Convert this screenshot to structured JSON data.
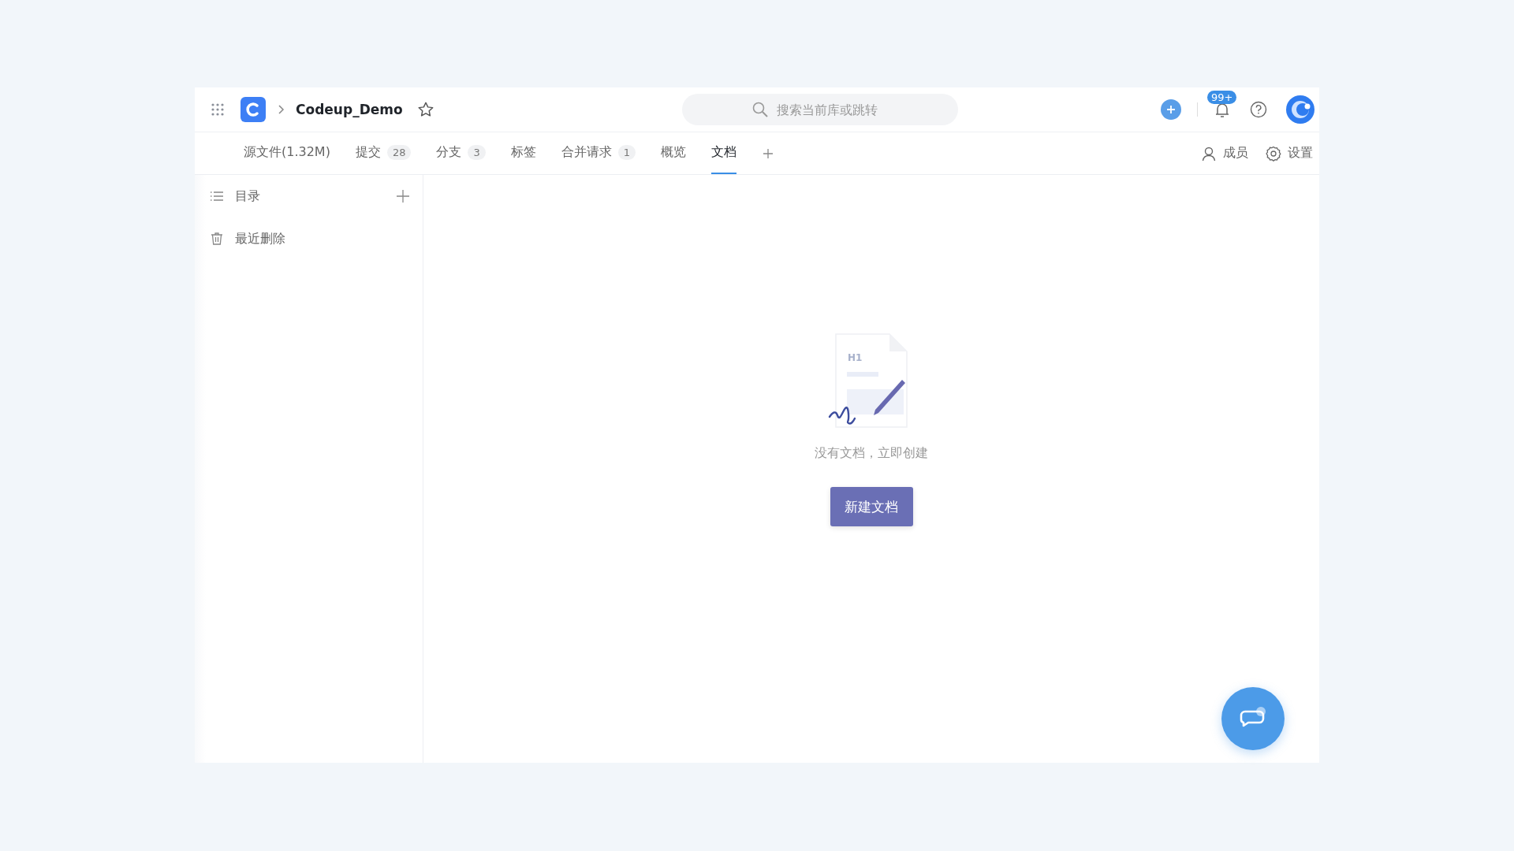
{
  "header": {
    "repo_name": "Codeup_Demo",
    "starred": false,
    "search": {
      "placeholder": "搜索当前库或跳转"
    },
    "notification_badge": "99+"
  },
  "tabs": [
    {
      "label": "源文件(1.32M)",
      "selected": false
    },
    {
      "label": "提交",
      "count": "28",
      "selected": false
    },
    {
      "label": "分支",
      "count": "3",
      "selected": false
    },
    {
      "label": "标签",
      "selected": false
    },
    {
      "label": "合并请求",
      "count": "1",
      "selected": false
    },
    {
      "label": "概览",
      "selected": false
    },
    {
      "label": "文档",
      "selected": true
    }
  ],
  "tab_actions": [
    {
      "kind": "members",
      "label": "成员"
    },
    {
      "kind": "settings",
      "label": "设置"
    }
  ],
  "sidebar": {
    "items": [
      {
        "kind": "toc",
        "label": "目录"
      },
      {
        "kind": "trash",
        "label": "最近删除"
      }
    ]
  },
  "empty_state": {
    "illustration_label": "H1",
    "message": "没有文档，立即创建",
    "button": "新建文档"
  }
}
